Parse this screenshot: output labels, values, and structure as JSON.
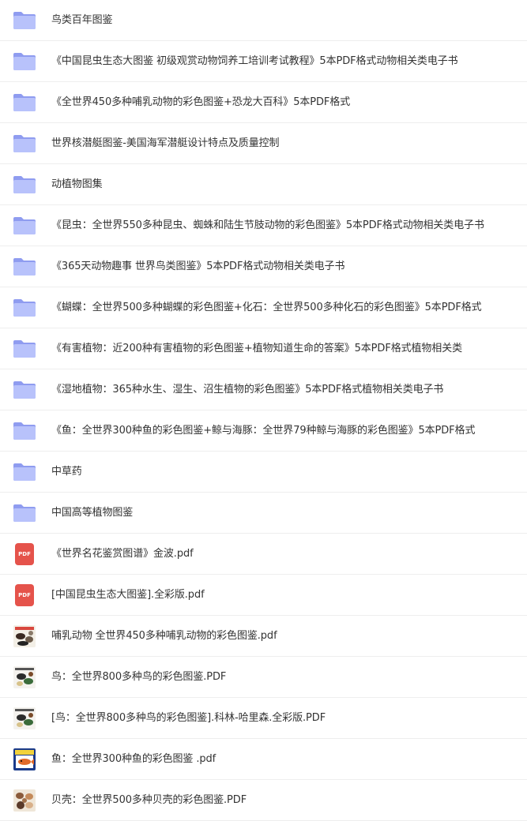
{
  "files": [
    {
      "type": "folder",
      "name": "鸟类百年图鉴"
    },
    {
      "type": "folder",
      "name": "《中国昆虫生态大图鉴 初级观赏动物饲养工培训考试教程》5本PDF格式动物相关类电子书"
    },
    {
      "type": "folder",
      "name": "《全世界450多种哺乳动物的彩色图鉴+恐龙大百科》5本PDF格式"
    },
    {
      "type": "folder",
      "name": "世界核潜艇图鉴-美国海军潜艇设计特点及质量控制"
    },
    {
      "type": "folder",
      "name": "动植物图集"
    },
    {
      "type": "folder",
      "name": "《昆虫：全世界550多种昆虫、蜘蛛和陆生节肢动物的彩色图鉴》5本PDF格式动物相关类电子书"
    },
    {
      "type": "folder",
      "name": "《365天动物趣事 世界鸟类图鉴》5本PDF格式动物相关类电子书"
    },
    {
      "type": "folder",
      "name": "《蝴蝶：全世界500多种蝴蝶的彩色图鉴+化石：全世界500多种化石的彩色图鉴》5本PDF格式"
    },
    {
      "type": "folder",
      "name": "《有害植物：近200种有害植物的彩色图鉴+植物知道生命的答案》5本PDF格式植物相关类"
    },
    {
      "type": "folder",
      "name": "《湿地植物：365种水生、湿生、沼生植物的彩色图鉴》5本PDF格式植物相关类电子书"
    },
    {
      "type": "folder",
      "name": "《鱼：全世界300种鱼的彩色图鉴+鲸与海豚：全世界79种鲸与海豚的彩色图鉴》5本PDF格式"
    },
    {
      "type": "folder",
      "name": "中草药"
    },
    {
      "type": "folder",
      "name": "中国高等植物图鉴"
    },
    {
      "type": "pdf",
      "name": "《世界名花鉴赏图谱》金波.pdf",
      "badge": "PDF"
    },
    {
      "type": "pdf",
      "name": "[中国昆虫生态大图鉴].全彩版.pdf",
      "badge": "PDF"
    },
    {
      "type": "thumb-animal",
      "name": "哺乳动物 全世界450多种哺乳动物的彩色图鉴.pdf"
    },
    {
      "type": "thumb-bird",
      "name": "鸟：全世界800多种鸟的彩色图鉴.PDF"
    },
    {
      "type": "thumb-bird",
      "name": "[鸟：全世界800多种鸟的彩色图鉴].科林-哈里森.全彩版.PDF"
    },
    {
      "type": "thumb-fish",
      "name": "鱼：全世界300种鱼的彩色图鉴 .pdf"
    },
    {
      "type": "thumb-shell",
      "name": "贝壳：全世界500多种贝壳的彩色图鉴.PDF"
    }
  ],
  "colors": {
    "folder_back": "#8f9cf0",
    "folder_front": "#b8c2fb",
    "pdf_red": "#e5534b"
  }
}
